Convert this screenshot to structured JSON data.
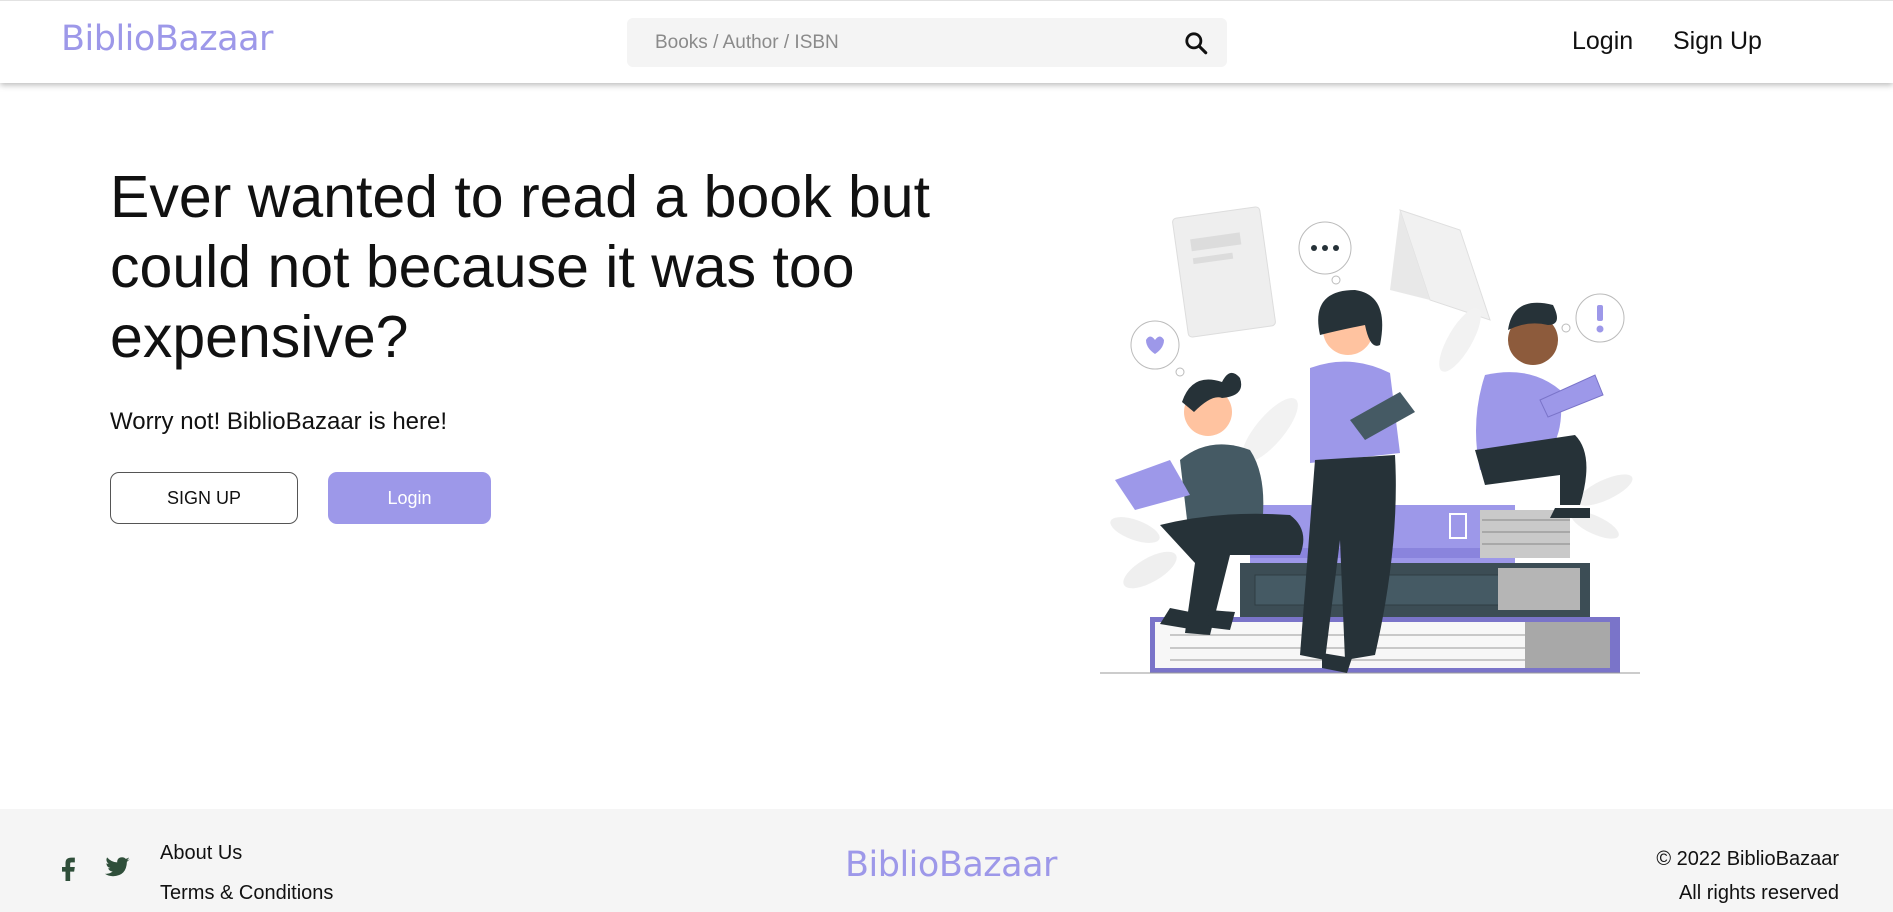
{
  "header": {
    "logo": "BiblioBazaar",
    "search": {
      "placeholder": "Books / Author / ISBN",
      "value": "",
      "icon": "search-icon"
    },
    "nav": {
      "login": "Login",
      "signup": "Sign Up"
    }
  },
  "hero": {
    "title": "Ever wanted to read a book but could not because it was too expensive?",
    "subtitle": "Worry not! BiblioBazaar is here!",
    "signup_button": "SIGN UP",
    "login_button": "Login",
    "illustration": "reading-people-illustration"
  },
  "footer": {
    "social": [
      "facebook-icon",
      "twitter-icon"
    ],
    "links": {
      "about": "About Us",
      "terms": "Terms & Conditions"
    },
    "logo": "BiblioBazaar",
    "copyright": "© 2022 BiblioBazaar",
    "rights": "All rights reserved"
  },
  "colors": {
    "accent": "#9d98e9",
    "dark": "#263238",
    "footer_bg": "#f5f5f5",
    "social_icon": "#2f4f3a"
  }
}
